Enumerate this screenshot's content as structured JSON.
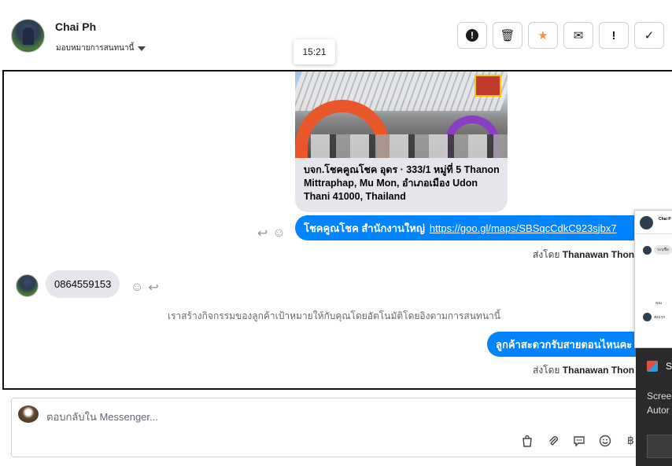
{
  "header": {
    "contact_name": "Chai Ph",
    "assign_label": "มอบหมายการสนทนานี้",
    "toolbar": {
      "spam_icon": "!",
      "delete_icon": "🗑",
      "star_icon": "★",
      "mail_icon": "✉",
      "follow_up_icon": "!",
      "done_icon": "✓"
    }
  },
  "tooltip": {
    "time": "15:21"
  },
  "conversation": {
    "link_card": {
      "text": "บจก.โชคคูณโชค อุดร · 333/1 หมู่ที่ 5 Thanon Mittraphap, Mu Mon, อำเภอเมือง Udon Thani 41000, Thailand"
    },
    "outgoing_1": {
      "text": "โชคคูณโชค สำนักงานใหญ่",
      "link": "https://goo.gl/maps/SBSqcCdkC923sjbx7"
    },
    "sent_by_1": {
      "prefix": "ส่งโดย",
      "name": "Thanawan Thon"
    },
    "incoming_1": {
      "text": "0864559153"
    },
    "system_note": "เราสร้างกิจกรรมของลูกค้าเป้าหมายให้กับคุณโดยอัตโนมัติโดยอิงตามการสนทนานี้",
    "outgoing_2": {
      "text": "ลูกค้าสะดวกรับสายตอนไหนคะ"
    },
    "sent_by_2": {
      "prefix": "ส่งโดย",
      "name": "Thanawan Thon"
    },
    "react_icons": {
      "smile": "☺",
      "reply": "↩"
    }
  },
  "mini_window": {
    "title": "Chai P",
    "row1": "ระบุชื่อ",
    "row2": "คุณ",
    "row3": "ส่งแรก"
  },
  "notification": {
    "title": "Sn",
    "line1": "Scree",
    "line2": "Autor"
  },
  "composer": {
    "placeholder": "ตอบกลับใน Messenger...",
    "tools": [
      "bag-icon",
      "attachment-icon",
      "saved-reply-icon",
      "emoji-icon",
      "currency-icon"
    ]
  }
}
